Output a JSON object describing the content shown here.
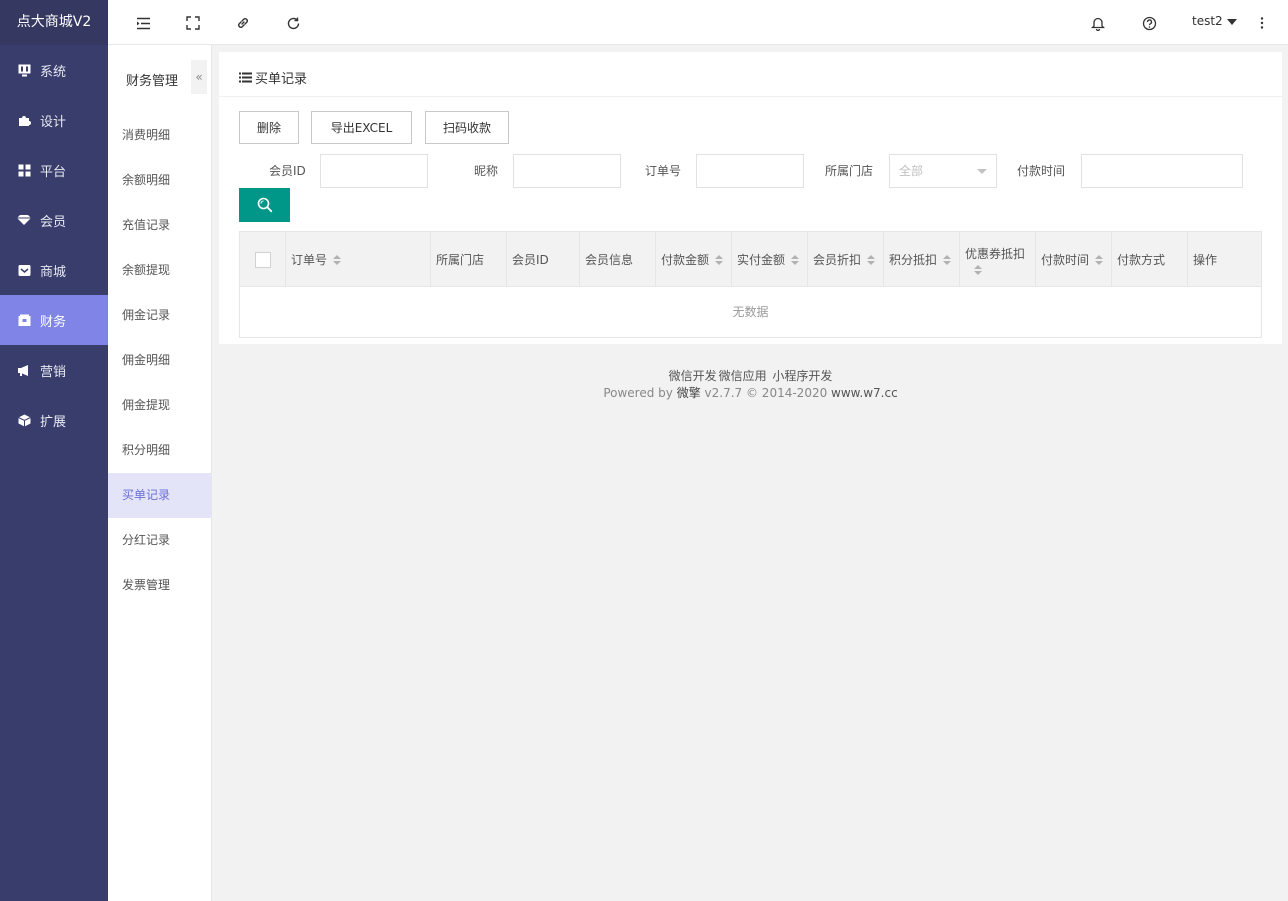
{
  "app": {
    "title": "点大商城V2"
  },
  "sidebar": {
    "items": [
      {
        "label": "系统",
        "icon": "monitor-icon"
      },
      {
        "label": "设计",
        "icon": "puzzle-icon"
      },
      {
        "label": "平台",
        "icon": "grid-icon"
      },
      {
        "label": "会员",
        "icon": "diamond-icon"
      },
      {
        "label": "商城",
        "icon": "inbox-icon"
      },
      {
        "label": "财务",
        "icon": "wallet-icon",
        "active": true
      },
      {
        "label": "营销",
        "icon": "megaphone-icon"
      },
      {
        "label": "扩展",
        "icon": "cube-icon"
      }
    ],
    "active_color": "#7f84e6",
    "bg_color": "#393d6b"
  },
  "subnav": {
    "title": "财务管理",
    "collapse_icon": "«",
    "items": [
      {
        "label": "消费明细"
      },
      {
        "label": "余额明细"
      },
      {
        "label": "充值记录"
      },
      {
        "label": "余额提现"
      },
      {
        "label": "佣金记录"
      },
      {
        "label": "佣金明细"
      },
      {
        "label": "佣金提现"
      },
      {
        "label": "积分明细"
      },
      {
        "label": "买单记录",
        "active": true
      },
      {
        "label": "分红记录"
      },
      {
        "label": "发票管理"
      }
    ]
  },
  "header": {
    "user": "test2"
  },
  "page": {
    "title": "买单记录",
    "buttons": {
      "delete": "删除",
      "export": "导出EXCEL",
      "scan": "扫码收款"
    },
    "filters": {
      "member_id": "会员ID",
      "nickname": "昵称",
      "order_no": "订单号",
      "store": "所属门店",
      "store_value": "全部",
      "pay_time": "付款时间"
    },
    "search_color": "#009688"
  },
  "table": {
    "columns": [
      {
        "label": "订单号",
        "sortable": true
      },
      {
        "label": "所属门店",
        "sortable": false
      },
      {
        "label": "会员ID",
        "sortable": false
      },
      {
        "label": "会员信息",
        "sortable": false
      },
      {
        "label": "付款金额",
        "sortable": true
      },
      {
        "label": "实付金额",
        "sortable": true
      },
      {
        "label": "会员折扣",
        "sortable": true
      },
      {
        "label": "积分抵扣",
        "sortable": true
      },
      {
        "label": "优惠券抵扣",
        "sortable": true
      },
      {
        "label": "付款时间",
        "sortable": true
      },
      {
        "label": "付款方式",
        "sortable": false
      },
      {
        "label": "操作",
        "sortable": false
      }
    ],
    "empty_text": "无数据"
  },
  "footer": {
    "links": [
      "微信开发",
      "微信应用",
      "小程序开发"
    ],
    "powered_prefix": "Powered by",
    "brand": "微擎",
    "version": "v2.7.7 © 2014-2020",
    "site": "www.w7.cc"
  }
}
